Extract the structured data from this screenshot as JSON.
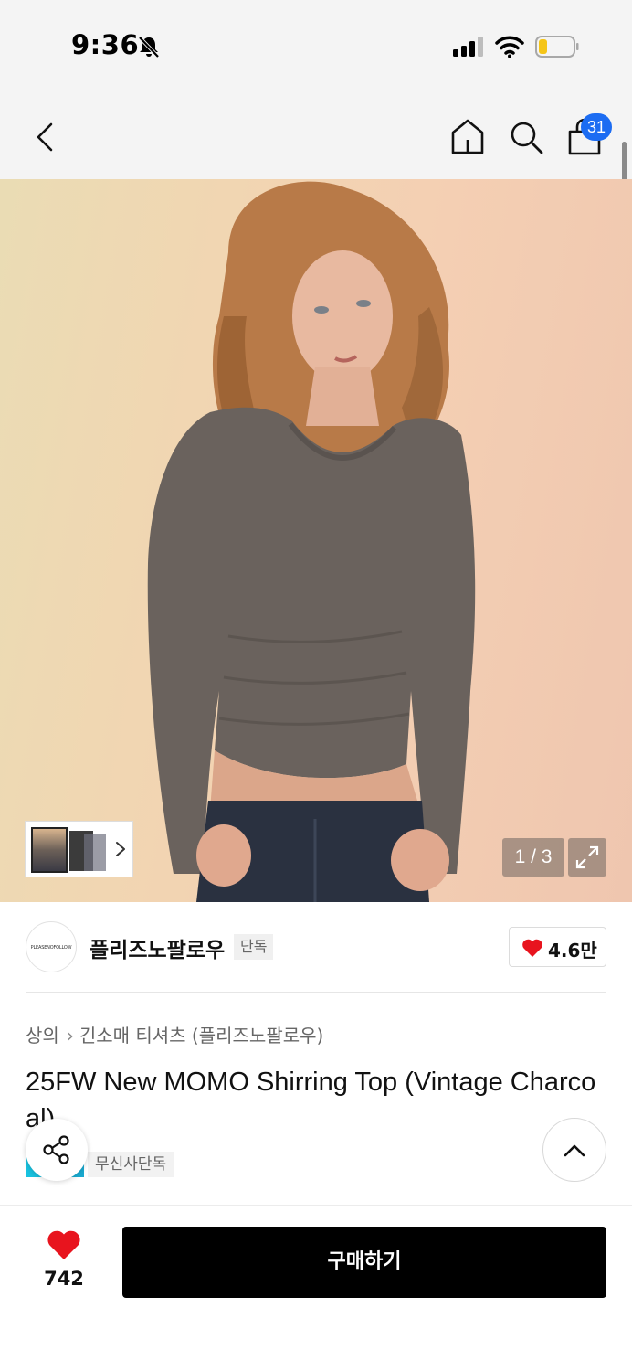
{
  "status_bar": {
    "time": "9:36",
    "icons": [
      "bell-off-icon",
      "signal-icon",
      "wifi-icon",
      "battery-icon"
    ]
  },
  "nav": {
    "icons": [
      "back-icon",
      "home-icon",
      "search-icon",
      "cart-icon"
    ],
    "cart_count": "31"
  },
  "gallery": {
    "counter": "1 / 3",
    "current_page": 1,
    "total_pages": 3
  },
  "brand": {
    "logo_text": "PLEASENOFOLLOW",
    "name": "플리즈노팔로우",
    "tag": "단독",
    "likes": "4.6만"
  },
  "product": {
    "breadcrumb": [
      "상의",
      "긴소매 티셔츠 (플리즈노팔로우)"
    ],
    "title": "25FW New MOMO Shirring Top (Vintage Charcoal)",
    "exclusive_label": "무신사단독"
  },
  "bottom_bar": {
    "wish_count": "742",
    "buy_label": "구매하기"
  },
  "colors": {
    "accent_red": "#e8141e",
    "badge_blue": "#1c6cf2",
    "buy_button": "#000000"
  }
}
